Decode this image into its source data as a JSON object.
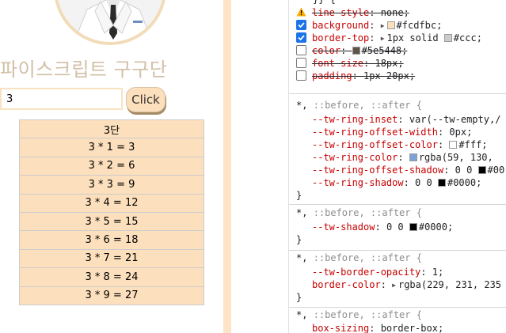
{
  "preview": {
    "title": "파이스크립트 구구단",
    "input_value": "3",
    "button_label": "Click",
    "table_header": "3단",
    "rows": [
      "3 * 1 = 3",
      "3 * 2 = 6",
      "3 * 3 = 9",
      "3 * 4 = 12",
      "3 * 5 = 15",
      "3 * 6 = 18",
      "3 * 7 = 21",
      "3 * 8 = 24",
      "3 * 9 = 27"
    ],
    "colors": {
      "accent": "#fcdfbc",
      "title": "#d1bfa6",
      "border": "#cccccc"
    }
  },
  "devtools": {
    "rule1": {
      "brace_top": "}} {",
      "decls": [
        {
          "prop": "line-style",
          "value": "none;",
          "icon": "warning-icon",
          "struck": true
        },
        {
          "prop": "background",
          "value": "#fcdfbc;",
          "checked": true,
          "swatch": "#fcdfbc"
        },
        {
          "prop": "border-top",
          "value": "1px solid",
          "value2": "#ccc;",
          "checked": true,
          "swatch": "#cccccc"
        },
        {
          "prop": "color",
          "value": "#5e5448;",
          "checked": false,
          "swatch": "#5e5448",
          "struck": true
        },
        {
          "prop": "font-size",
          "value": "18px;",
          "checked": false,
          "struck": true
        },
        {
          "prop": "padding",
          "value": "1px 20px;",
          "checked": false,
          "struck": true
        }
      ]
    },
    "rule2": {
      "selector_main": "*,",
      "selector_pseudo": "::before, ::after {",
      "decls": [
        {
          "prop": "--tw-ring-inset",
          "value": "var(--tw-empty,/"
        },
        {
          "prop": "--tw-ring-offset-width",
          "value": "0px;"
        },
        {
          "prop": "--tw-ring-offset-color",
          "value": "#fff;",
          "swatch": "#ffffff"
        },
        {
          "prop": "--tw-ring-color",
          "value": "rgba(59, 130,",
          "swatch": "#7fa2d6"
        },
        {
          "prop": "--tw-ring-offset-shadow",
          "value": "0 0",
          "value2": "#00",
          "swatch": "#000000"
        },
        {
          "prop": "--tw-ring-shadow",
          "value": "0 0",
          "value2": "#0000;",
          "swatch": "#000000"
        }
      ],
      "close": "}"
    },
    "rule3": {
      "selector_main": "*,",
      "selector_pseudo": "::before, ::after {",
      "decls": [
        {
          "prop": "--tw-shadow",
          "value": "0 0",
          "value2": "#0000;",
          "swatch": "#000000"
        }
      ],
      "close": "}"
    },
    "rule4": {
      "selector_main": "*,",
      "selector_pseudo": "::before, ::after {",
      "decls": [
        {
          "prop": "--tw-border-opacity",
          "value": "1;"
        },
        {
          "prop": "border-color",
          "value": "rgba(229, 231, 235"
        }
      ],
      "close": "}"
    },
    "rule5": {
      "selector_main": "*,",
      "selector_pseudo": "::before, ::after {",
      "decls": [
        {
          "prop": "box-sizing",
          "value": "border-box;"
        }
      ]
    }
  }
}
